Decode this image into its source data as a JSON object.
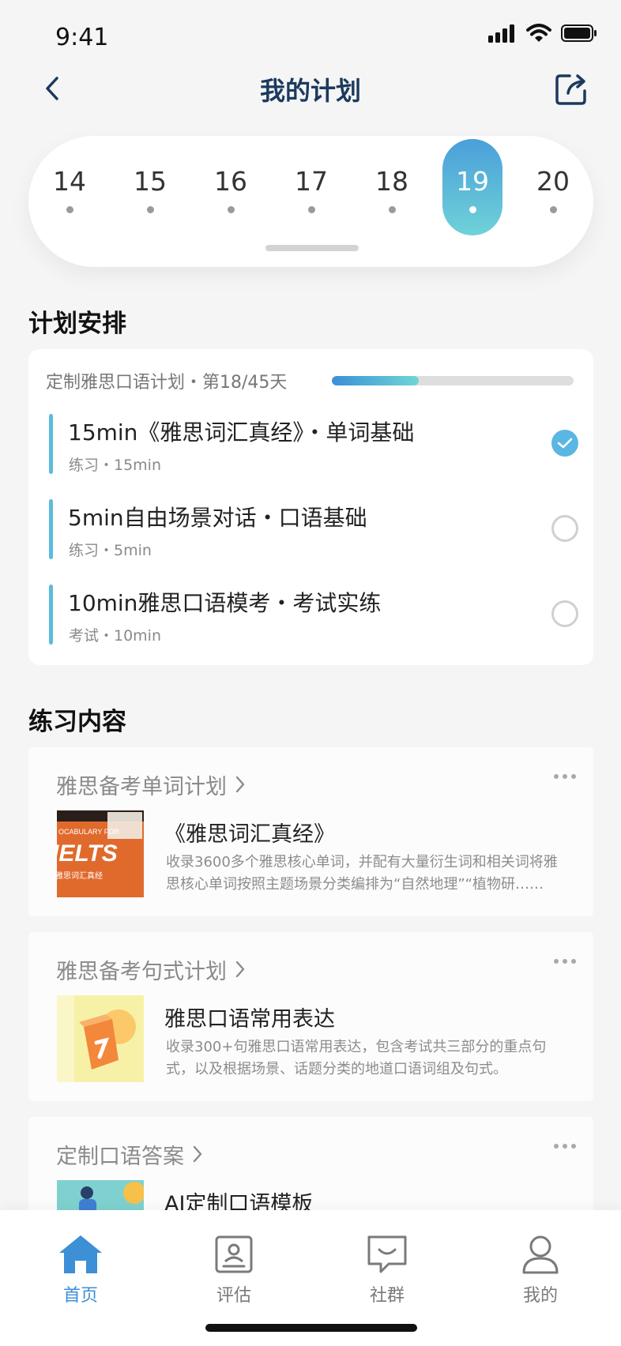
{
  "status": {
    "time": "9:41"
  },
  "nav": {
    "title": "我的计划"
  },
  "dates": [
    {
      "num": "14",
      "active": false
    },
    {
      "num": "15",
      "active": false
    },
    {
      "num": "16",
      "active": false
    },
    {
      "num": "17",
      "active": false
    },
    {
      "num": "18",
      "active": false
    },
    {
      "num": "19",
      "active": true
    },
    {
      "num": "20",
      "active": false
    }
  ],
  "plan": {
    "section_title": "计划安排",
    "progress_label": "定制雅思口语计划・第18/45天",
    "progress_fraction": 0.36,
    "progress_colors": {
      "start": "#3c8fd6",
      "end": "#6fd6d6"
    },
    "tasks": [
      {
        "title": "15min《雅思词汇真经》・单词基础",
        "meta": "练习・15min",
        "done": true
      },
      {
        "title": "5min自由场景对话・口语基础",
        "meta": "练习・5min",
        "done": false
      },
      {
        "title": "10min雅思口语模考・考试实练",
        "meta": "考试・10min",
        "done": false
      }
    ]
  },
  "practice": {
    "section_title": "练习内容",
    "cards": [
      {
        "head": "雅思备考单词计划",
        "item_title": "《雅思词汇真经》",
        "item_desc": "收录3600多个雅思核心单词，并配有大量衍生词和相关词将雅思核心单词按照主题场景分类编排为“自然地理”“植物研……",
        "thumb": {
          "text1": "OCABULARY FOR",
          "text2": "IELTS",
          "text3": "雅思词汇真经"
        }
      },
      {
        "head": "雅思备考句式计划",
        "item_title": "雅思口语常用表达",
        "item_desc": "收录300+句雅思口语常用表达，包含考试共三部分的重点句式，以及根据场景、话题分类的地道口语词组及句式。"
      },
      {
        "head": "定制口语答案",
        "item_title": "AI定制口语模板",
        "item_desc": ""
      }
    ]
  },
  "tabs": [
    {
      "label": "首页",
      "icon": "home-icon",
      "active": true
    },
    {
      "label": "评估",
      "icon": "assessment-icon",
      "active": false
    },
    {
      "label": "社群",
      "icon": "chat-icon",
      "active": false
    },
    {
      "label": "我的",
      "icon": "profile-icon",
      "active": false
    }
  ],
  "colors": {
    "accent": "#3d8fd6",
    "title": "#1c3a5e",
    "check": "#5ab6e3",
    "task_bar": "#5dbbdc"
  }
}
